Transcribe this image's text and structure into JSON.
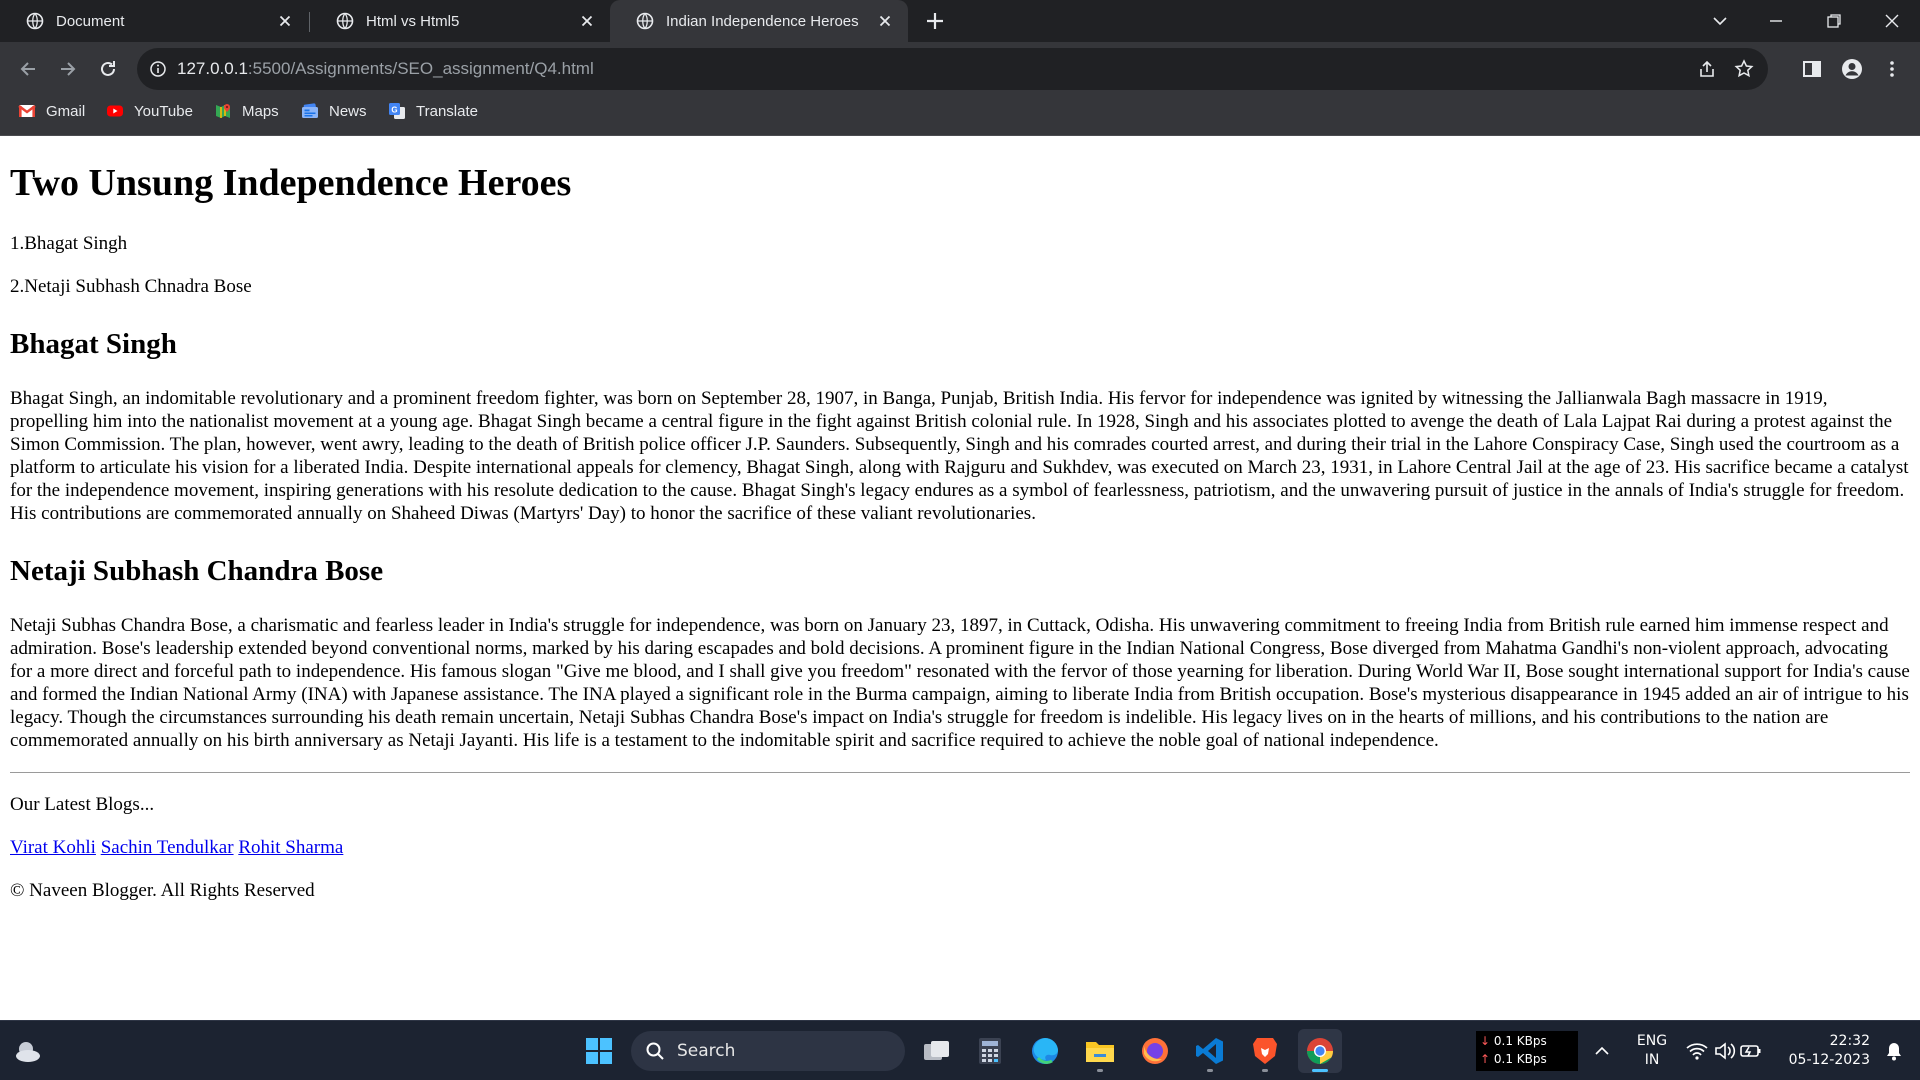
{
  "browser": {
    "tabs": [
      {
        "title": "Document",
        "active": false
      },
      {
        "title": "Html vs Html5",
        "active": false
      },
      {
        "title": "Indian Independence Heroes",
        "active": true
      }
    ],
    "url": {
      "host": "127.0.0.1",
      "path": ":5500/Assignments/SEO_assignment/Q4.html"
    },
    "bookmarks": [
      "Gmail",
      "YouTube",
      "Maps",
      "News",
      "Translate"
    ]
  },
  "page": {
    "title": "Two Unsung Independence Heroes",
    "list": [
      "1.Bhagat Singh",
      "2.Netaji Subhash Chnadra Bose"
    ],
    "sections": [
      {
        "heading": "Bhagat Singh",
        "body": "Bhagat Singh, an indomitable revolutionary and a prominent freedom fighter, was born on September 28, 1907, in Banga, Punjab, British India. His fervor for independence was ignited by witnessing the Jallianwala Bagh massacre in 1919, propelling him into the nationalist movement at a young age. Bhagat Singh became a central figure in the fight against British colonial rule. In 1928, Singh and his associates plotted to avenge the death of Lala Lajpat Rai during a protest against the Simon Commission. The plan, however, went awry, leading to the death of British police officer J.P. Saunders. Subsequently, Singh and his comrades courted arrest, and during their trial in the Lahore Conspiracy Case, Singh used the courtroom as a platform to articulate his vision for a liberated India. Despite international appeals for clemency, Bhagat Singh, along with Rajguru and Sukhdev, was executed on March 23, 1931, in Lahore Central Jail at the age of 23. His sacrifice became a catalyst for the independence movement, inspiring generations with his resolute dedication to the cause. Bhagat Singh's legacy endures as a symbol of fearlessness, patriotism, and the unwavering pursuit of justice in the annals of India's struggle for freedom. His contributions are commemorated annually on Shaheed Diwas (Martyrs' Day) to honor the sacrifice of these valiant revolutionaries."
      },
      {
        "heading": "Netaji Subhash Chandra Bose",
        "body": "Netaji Subhas Chandra Bose, a charismatic and fearless leader in India's struggle for independence, was born on January 23, 1897, in Cuttack, Odisha. His unwavering commitment to freeing India from British rule earned him immense respect and admiration. Bose's leadership extended beyond conventional norms, marked by his daring escapades and bold decisions. A prominent figure in the Indian National Congress, Bose diverged from Mahatma Gandhi's non-violent approach, advocating for a more direct and forceful path to independence. His famous slogan \"Give me blood, and I shall give you freedom\" resonated with the fervor of those yearning for liberation. During World War II, Bose sought international support for India's cause and formed the Indian National Army (INA) with Japanese assistance. The INA played a significant role in the Burma campaign, aiming to liberate India from British occupation. Bose's mysterious disappearance in 1945 added an air of intrigue to his legacy. Though the circumstances surrounding his death remain uncertain, Netaji Subhas Chandra Bose's impact on India's struggle for freedom is indelible. His legacy lives on in the hearts of millions, and his contributions to the nation are commemorated annually on his birth anniversary as Netaji Jayanti. His life is a testament to the indomitable spirit and sacrifice required to achieve the noble goal of national independence."
      }
    ],
    "footer": {
      "blogs_label": "Our Latest Blogs...",
      "links": [
        "Virat Kohli",
        "Sachin Tendulkar",
        "Rohit Sharma"
      ],
      "copyright": "© Naveen Blogger. All Rights Reserved"
    }
  },
  "taskbar": {
    "search_label": "Search",
    "network": {
      "down": "0.1 KBps",
      "up": "0.1 KBps"
    },
    "language": {
      "line1": "ENG",
      "line2": "IN"
    },
    "time": "22:32",
    "date": "05-12-2023"
  },
  "colors": {
    "link": "#0000ee",
    "tab_strip": "#202124",
    "toolbar": "#35363a",
    "taskbar": "#1c2331",
    "accent": "#4cc2ff"
  }
}
